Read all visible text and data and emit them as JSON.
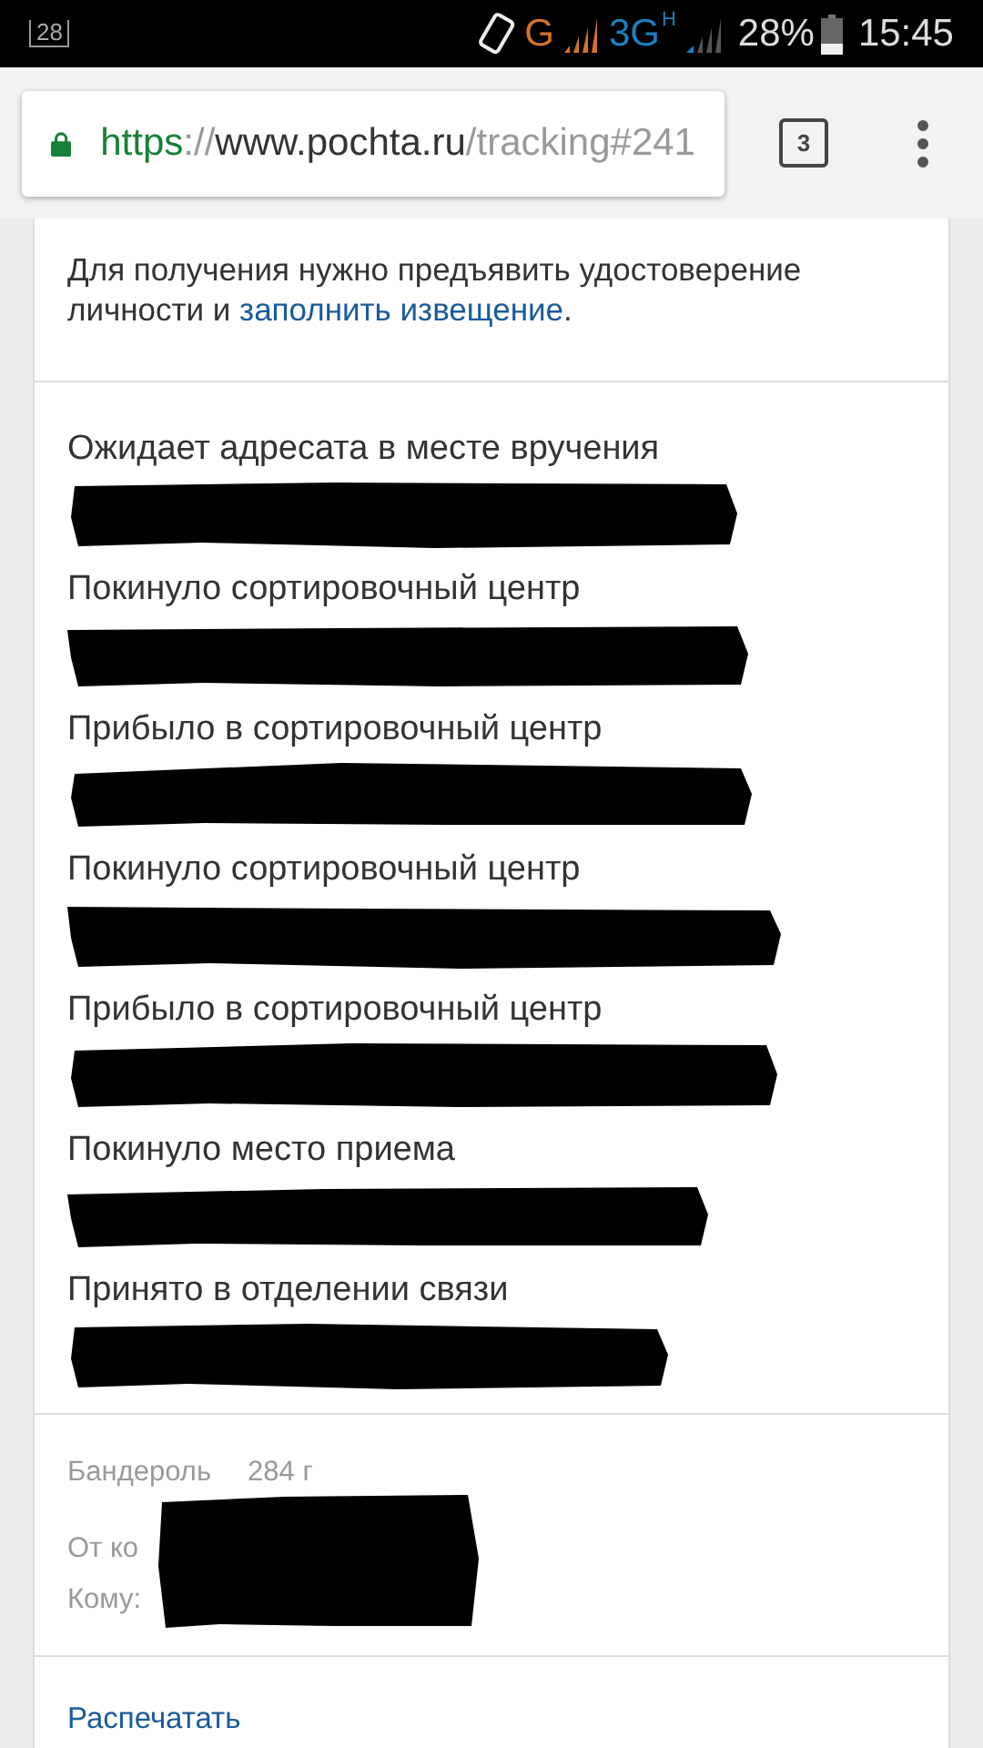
{
  "status_bar": {
    "notification_count": "28",
    "network": "G",
    "network_fast": "3G",
    "network_fast_mark": "H",
    "battery": "28%",
    "time": "15:45"
  },
  "browser": {
    "url_scheme": "https",
    "url_separator": "://",
    "url_host": "www.pochta.ru",
    "url_path": "/tracking#241",
    "tab_count": "3"
  },
  "notice": {
    "text": "Для получения нужно предъявить удостоверение личности и ",
    "link": "заполнить извещение",
    "text_end": "."
  },
  "events": [
    {
      "status": "Ожидает адресата в месте вручения",
      "redacted": true
    },
    {
      "status": "Покинуло сортировочный центр",
      "redacted": true
    },
    {
      "status": "Прибыло в сортировочный центр",
      "redacted": true
    },
    {
      "status": "Покинуло сортировочный центр",
      "redacted": true
    },
    {
      "status": "Прибыло в сортировочный центр",
      "redacted": true
    },
    {
      "status": "Покинуло место приема",
      "redacted": true
    },
    {
      "status": "Принято в отделении связи",
      "redacted": true
    }
  ],
  "details": {
    "package_type": "Бандероль",
    "weight": "284 г",
    "from_label": "От ко",
    "to_label": "Кому:",
    "redacted": true
  },
  "print_link": "Распечатать"
}
